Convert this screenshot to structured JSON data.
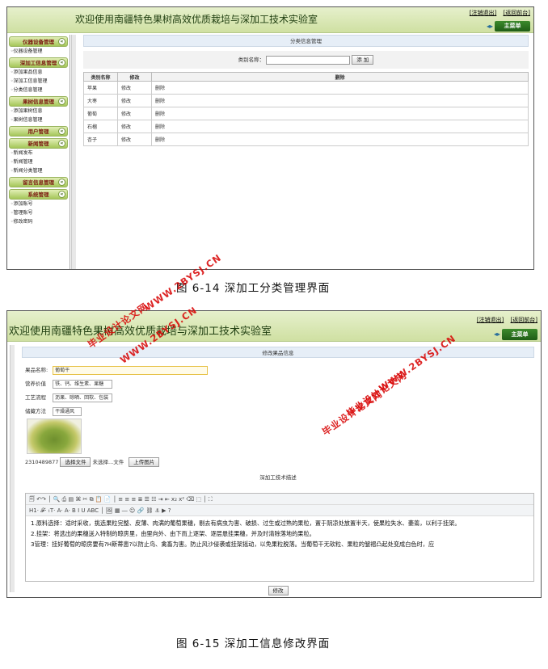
{
  "figure1": {
    "header_title": "欢迎使用南疆特色果树高效优质栽培与深加工技术实验室",
    "logout_link": "[注销退出]",
    "back_link": "[返回前台]",
    "main_menu": "主菜单",
    "sidebar": [
      {
        "group": "仪器设备管理",
        "items": [
          "仪器设备管理"
        ]
      },
      {
        "group": "深加工信息管理",
        "items": [
          "添加果品信息",
          "深加工信息管理",
          "分类信息管理"
        ]
      },
      {
        "group": "果树信息管理",
        "items": [
          "添加果树信息",
          "果树信息管理"
        ]
      },
      {
        "group": "用户管理",
        "items": []
      },
      {
        "group": "新闻管理",
        "items": [
          "新闻发布",
          "新闻管理",
          "新闻分类管理"
        ]
      },
      {
        "group": "留言信息管理",
        "items": []
      },
      {
        "group": "系统管理",
        "items": [
          "添加账号",
          "管理账号",
          "修改密码"
        ]
      }
    ],
    "section_title": "分类信息管理",
    "filter_label": "类别名称：",
    "add_button": "添 加",
    "table": {
      "headers": [
        "类别名称",
        "修改",
        "删除"
      ],
      "rows": [
        [
          "苹果",
          "修改",
          "删除"
        ],
        [
          "大枣",
          "修改",
          "删除"
        ],
        [
          "葡萄",
          "修改",
          "删除"
        ],
        [
          "石榴",
          "修改",
          "删除"
        ],
        [
          "杏子",
          "修改",
          "删除"
        ]
      ]
    },
    "caption": "图 6-14   深加工分类管理界面"
  },
  "figure2": {
    "header_title": "欢迎使用南疆特色果树高效优质栽培与深加工技术实验室",
    "logout_link": "[注销退出]",
    "back_link": "[返回前台]",
    "main_menu": "主菜单",
    "section_title": "修改果品信息",
    "fields": [
      {
        "label": "果品名称:",
        "value": "葡萄干"
      },
      {
        "label": "营养价值",
        "value": "铁、钙、维生素、果糖"
      },
      {
        "label": "工艺流程",
        "value": "沥果、晾晒、回软、包装"
      },
      {
        "label": "储藏方法",
        "value": "干燥通风"
      }
    ],
    "file_name": "2310489877",
    "choose_file_button": "选择文件",
    "no_file_text": "未选择...文件",
    "upload_button": "上传图片",
    "desc_label": "深加工技术描述",
    "toolbar_row2_prefix": "H1·  𝓕·  ₜT·  A·  A·  B  I  U  ABC",
    "editor_lines": [
      "1.原料选择：适时采收，挑选果粒完整、皮薄、肉满的葡萄果穗，剔去有病虫为害、破损、过生或过熟的果粒，置于阴凉处放置半天，使果粒失水、萎蔫，以利于挂架。",
      "2.挂架：将选出的果穗送入特制的晾房里，由里向外、由下而上逐架、逐层悬挂果穗，并及时清除落地的果粒。",
      "3管理：挂好葡萄的晾房要有?H斯蒂患?以防止鸟、禽畜为害。防止风沙侵袭或挂架摇动，以免果粒脱落。当葡萄干无软粒、果粒的皱褶凸起处变成白色时，应"
    ],
    "submit_button": "修改",
    "caption": "图 6-15   深加工信息修改界面"
  },
  "watermarks": {
    "url": "WWW.2BYSJ.CN",
    "site": "毕业设计论文网"
  }
}
